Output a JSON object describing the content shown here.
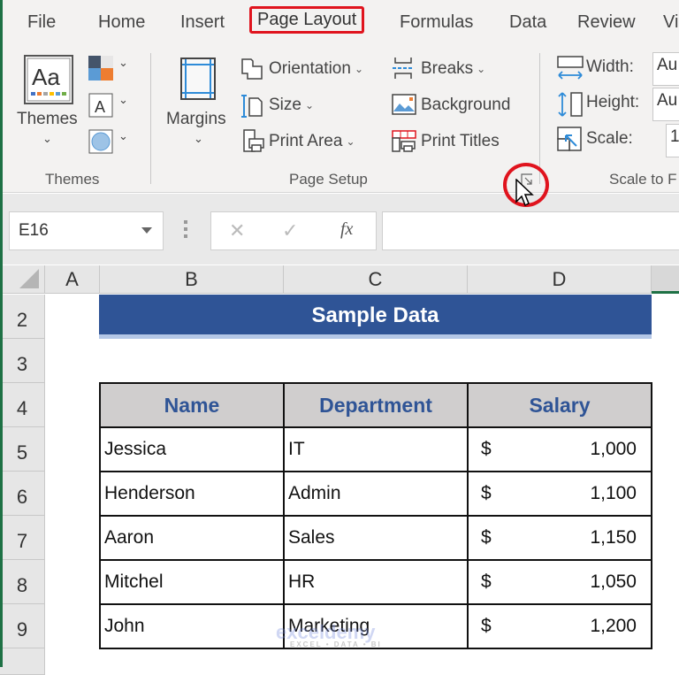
{
  "ribbon_tabs": [
    {
      "label": "File"
    },
    {
      "label": "Home"
    },
    {
      "label": "Insert"
    },
    {
      "label": "Page Layout",
      "active": true
    },
    {
      "label": "Formulas"
    },
    {
      "label": "Data"
    },
    {
      "label": "Review"
    },
    {
      "label": "Vi"
    }
  ],
  "groups": {
    "themes": {
      "label": "Themes",
      "themes_button": "Themes",
      "icons": [
        "themes-aa-icon",
        "colors-icon",
        "fonts-icon",
        "effects-icon"
      ]
    },
    "page_setup": {
      "label": "Page Setup",
      "margins": "Margins",
      "orientation": "Orientation",
      "size": "Size",
      "print_area": "Print Area",
      "breaks": "Breaks",
      "background": "Background",
      "print_titles": "Print Titles",
      "dialog_launcher_icon": "dialog-launcher-icon"
    },
    "scale_to_fit": {
      "label": "Scale to F",
      "width_label": "Width:",
      "width_value": "Au",
      "height_label": "Height:",
      "height_value": "Au",
      "scale_label": "Scale:",
      "scale_value": "1"
    }
  },
  "formula_bar": {
    "name_box": "E16",
    "cancel_icon": "✕",
    "enter_icon": "✓",
    "fx_label": "fx",
    "formula": ""
  },
  "columns": [
    "A",
    "B",
    "C",
    "D"
  ],
  "rows": [
    "2",
    "3",
    "4",
    "5",
    "6",
    "7",
    "8",
    "9"
  ],
  "sheet": {
    "title": "Sample Data",
    "headers": [
      "Name",
      "Department",
      "Salary"
    ],
    "records": [
      {
        "name": "Jessica",
        "department": "IT",
        "currency": "$",
        "salary": "1,000"
      },
      {
        "name": "Henderson",
        "department": "Admin",
        "currency": "$",
        "salary": "1,100"
      },
      {
        "name": "Aaron",
        "department": "Sales",
        "currency": "$",
        "salary": "1,150"
      },
      {
        "name": "Mitchel",
        "department": "HR",
        "currency": "$",
        "salary": "1,050"
      },
      {
        "name": "John",
        "department": "Marketing",
        "currency": "$",
        "salary": "1,200"
      }
    ]
  },
  "watermark": {
    "brand": "exceldemy",
    "tagline": "EXCEL • DATA • BI"
  },
  "colors": {
    "accent_red": "#e0141e",
    "header_blue": "#2f5496",
    "excel_green": "#1e7145",
    "header_gray": "#d0cece"
  }
}
